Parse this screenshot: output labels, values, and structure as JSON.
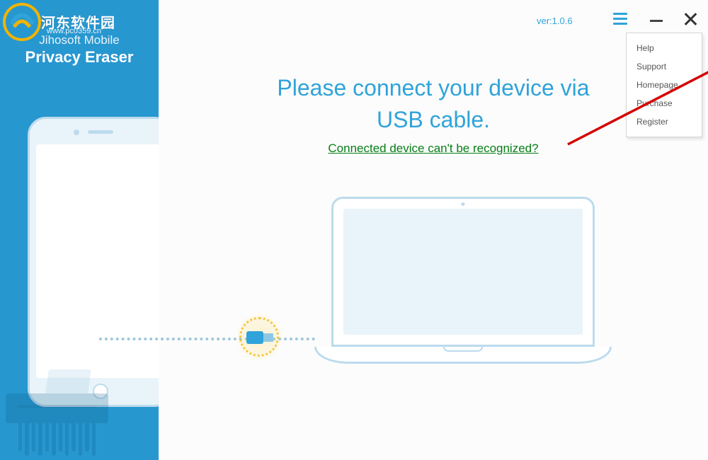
{
  "watermark": {
    "text": "河东软件园",
    "url": "www.pc0359.cn"
  },
  "app": {
    "brand_sub": "Jihosoft Mobile",
    "brand_main": "Privacy Eraser",
    "version_label": "ver:1.0.6"
  },
  "headline": {
    "line1": "Please connect your device via",
    "line2": "USB cable."
  },
  "help_link": "Connected device can't be recognized?",
  "menu": {
    "items": [
      {
        "label": "Help"
      },
      {
        "label": "Support"
      },
      {
        "label": "Homepage"
      },
      {
        "label": "Purchase"
      },
      {
        "label": "Register"
      }
    ]
  }
}
